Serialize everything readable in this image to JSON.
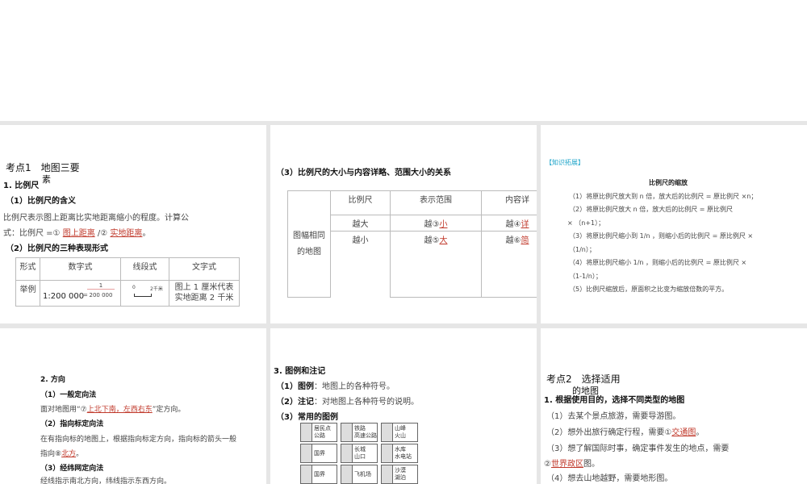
{
  "p1": {
    "title": "考点1　地图三要",
    "title_wrap": "素",
    "h1": "1. 比例尺",
    "h2": "（1）比例尺的含义",
    "line1": "比例尺表示图上距离比实地距离缩小的程度。计算公",
    "line2_pre": "式：比例尺 =①",
    "ans1": "图上距离",
    "line2_mid": "/②",
    "ans2": "实地距离",
    "line2_end": "。",
    "h3": "（2）比例尺的三种表现形式",
    "table": {
      "headers": [
        "形式",
        "数字式",
        "线段式",
        "文字式"
      ],
      "row_label": "举例",
      "numeric": "1:200 000",
      "fraction_num": "1",
      "fraction_den": "200 000",
      "eq": "=",
      "line_zero": "0",
      "line_end": "2千米",
      "text_form": "图上 1 厘米代表实地距离 2 千米"
    }
  },
  "p2": {
    "h": "（3）比例尺的大小与内容详略、范围大小的关系",
    "row_header": "图幅相同的地图",
    "headers": [
      "比例尺",
      "表示范围",
      "内容详"
    ],
    "rows": [
      {
        "scale": "越大",
        "range_pre": "越③",
        "range_ans": "小",
        "detail_pre": "越④",
        "detail_ans": "详"
      },
      {
        "scale": "越小",
        "range_pre": "越⑤",
        "range_ans": "大",
        "detail_pre": "越⑥",
        "detail_ans": "简"
      }
    ]
  },
  "p3": {
    "tag": "【知识拓展】",
    "title": "比例尺的缩放",
    "lines": [
      "（1）将原比例尺放大到 n 倍，放大后的比例尺 = 原比例尺 ×n；",
      "（2）将原比例尺放大 n 倍，放大后的比例尺 = 原比例尺",
      "× （n+1）；",
      "（3）将原比例尺缩小到 1/n ，则缩小后的比例尺 = 原比例尺 ×",
      "（1/n）；",
      "（4）将原比例尺缩小 1/n ，则缩小后的比例尺 = 原比例尺 ×",
      "（1-1/n）；",
      "（5）比例尺缩放后，原面积之比变为缩放倍数的平方。"
    ]
  },
  "p4": {
    "h": "2. 方向",
    "h1": "（1）一般定向法",
    "l1_pre": "面对地图用“⑦",
    "ans7": "上北下南，左西右东",
    "l1_end": "”定方向。",
    "h2": "（2）指向标定向法",
    "l2": "在有指向标的地图上，根据指向标定方向，指向标的箭头一般",
    "l3_pre": "指向⑧",
    "ans8": "北方",
    "l3_end": "。",
    "h3": "（3）经纬网定向法",
    "l4": "经线指示南北方向，纬线指示东西方向。"
  },
  "p5": {
    "h": "3. 图例和注记",
    "l1_b": "（1）图例",
    "l1": "：地图上的各种符号。",
    "l2_b": "（2）注记",
    "l2": "：对地图上各种符号的说明。",
    "h3": "（3）常用的图例",
    "legend": [
      [
        "居民点",
        "公路"
      ],
      [
        "铁路",
        "高速公路"
      ],
      [
        "山峰",
        "火山"
      ],
      [
        "国界"
      ],
      [
        "长城",
        "山口"
      ],
      [
        "水库",
        "水电站"
      ],
      [
        "国界"
      ],
      [
        "飞机场"
      ],
      [
        "沙漠",
        "湖泊"
      ]
    ]
  },
  "p6": {
    "title": "考点2　选择适用",
    "title_wrap": "的地图",
    "h1": "1. 根据使用目的，选择不同类型的地图",
    "l1": "（1）去某个景点旅游，需要导游图。",
    "l2_pre": "（2）想外出旅行确定行程，需要①",
    "ans1": "交通图",
    "l2_end": "。",
    "l3": "（3）想了解国际时事，确定事件发生的地点，需要",
    "l4_pre": "②",
    "ans2": "世界政区",
    "l4_end": "图。",
    "l5": "（4）想去山地越野，需要地形图。"
  }
}
